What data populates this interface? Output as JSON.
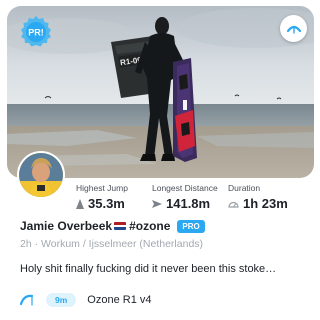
{
  "badge": {
    "text": "PR!"
  },
  "stats": [
    {
      "label": "Highest Jump",
      "value": "35.3m",
      "icon": "arrow-up-icon"
    },
    {
      "label": "Longest Distance",
      "value": "141.8m",
      "icon": "arrow-right-icon"
    },
    {
      "label": "Duration",
      "value": "1h 23m",
      "icon": "clock-icon"
    }
  ],
  "rider": {
    "name": "Jamie Overbeek",
    "hashtag": "#ozone",
    "badge": "PRO"
  },
  "meta": "2h · Workum / Ijsselmeer (Netherlands)",
  "caption": "Holy shit finally fucking did it never been this stoke…",
  "gear": {
    "size": "9m",
    "name": "Ozone R1 v4",
    "icon": "kite-icon"
  },
  "photo": {
    "kite_bag_text": "R1-09"
  },
  "colors": {
    "accent": "#2aa8f2",
    "accent_light": "#dff3fd",
    "text": "#1e2228",
    "muted": "#a4a9b0"
  }
}
